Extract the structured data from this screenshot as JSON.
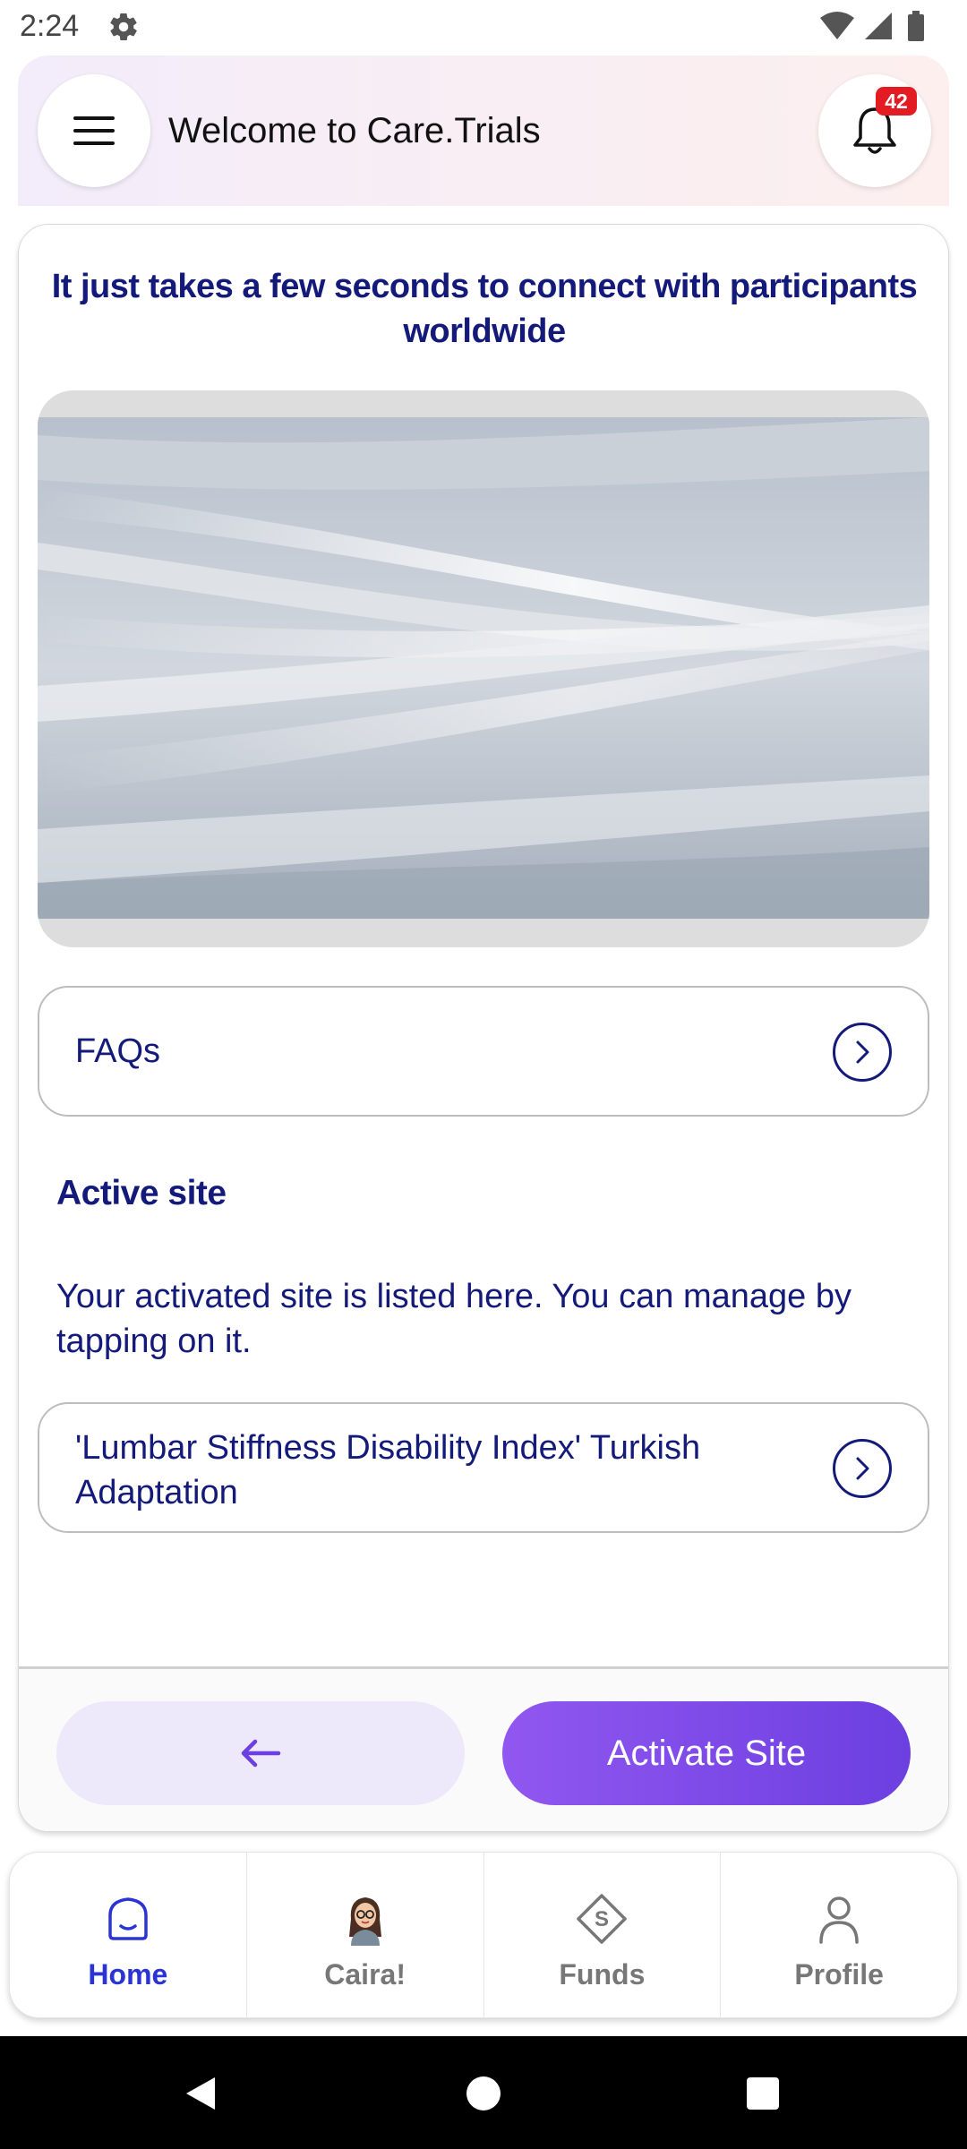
{
  "status_bar": {
    "time": "2:24"
  },
  "header": {
    "title": "Welcome to Care.Trials",
    "notification_count": "42"
  },
  "main": {
    "headline": "It just takes a few seconds to connect with participants worldwide",
    "faq": {
      "label": "FAQs"
    },
    "active_site": {
      "title": "Active site",
      "description": "Your activated site is listed here. You can manage by tapping on it.",
      "site_name": "'Lumbar Stiffness Disability Index' Turkish Adaptation"
    },
    "footer": {
      "activate_label": "Activate Site"
    }
  },
  "bottom_nav": {
    "items": [
      {
        "label": "Home",
        "icon": "home-icon",
        "active": true
      },
      {
        "label": "Caira!",
        "icon": "assistant-avatar-icon",
        "active": false
      },
      {
        "label": "Funds",
        "icon": "funds-icon",
        "active": false
      },
      {
        "label": "Profile",
        "icon": "profile-icon",
        "active": false
      }
    ]
  },
  "colors": {
    "accent_navy": "#141a7a",
    "accent_purple": "#6c3fe0",
    "badge_red": "#e31b23",
    "nav_active": "#2a33d6"
  }
}
